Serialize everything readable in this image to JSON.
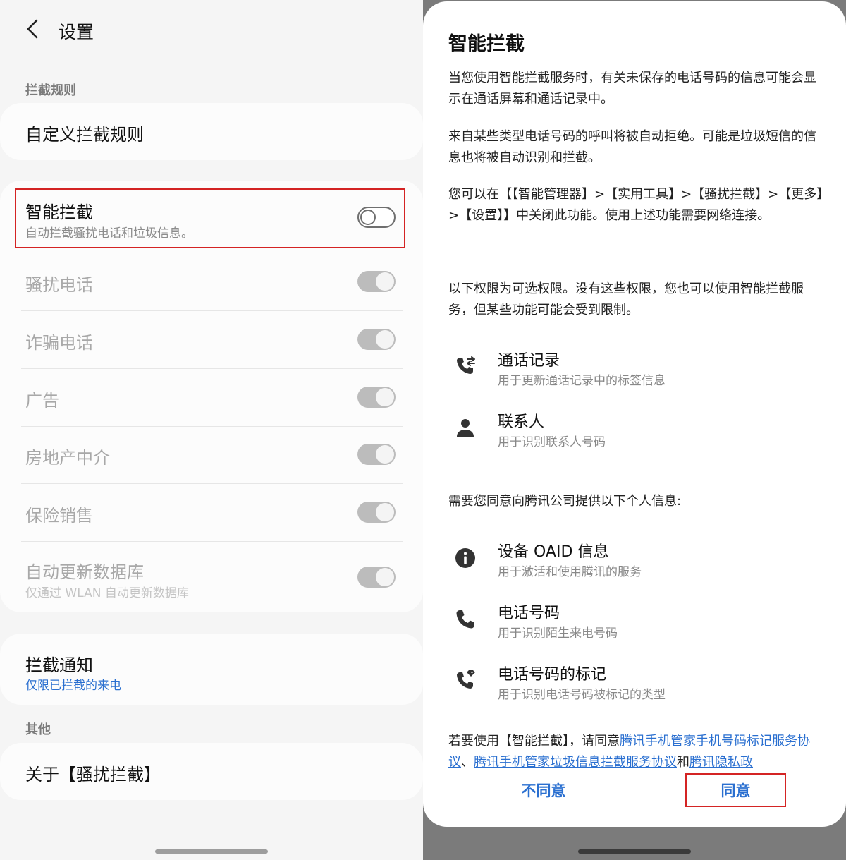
{
  "settings": {
    "title": "设置",
    "section_rules": "拦截规则",
    "custom_rules": "自定义拦截规则",
    "smart_block": {
      "title": "智能拦截",
      "subtitle": "自动拦截骚扰电话和垃圾信息。",
      "enabled": false
    },
    "categories": [
      {
        "label": "骚扰电话"
      },
      {
        "label": "诈骗电话"
      },
      {
        "label": "广告"
      },
      {
        "label": "房地产中介"
      },
      {
        "label": "保险销售"
      }
    ],
    "auto_update": {
      "title": "自动更新数据库",
      "subtitle": "仅通过 WLAN 自动更新数据库"
    },
    "block_notice": {
      "title": "拦截通知",
      "subtitle": "仅限已拦截的来电"
    },
    "section_other": "其他",
    "about": "关于【骚扰拦截】"
  },
  "dialog": {
    "title": "智能拦截",
    "p1": "当您使用智能拦截服务时，有关未保存的电话号码的信息可能会显示在通话屏幕和通话记录中。",
    "p2": "来自某些类型电话号码的呼叫将被自动拒绝。可能是垃圾短信的信息也将被自动识别和拦截。",
    "p3": "您可以在【【智能管理器】>【实用工具】>【骚扰拦截】>【更多】>【设置】】中关闭此功能。使用上述功能需要网络连接。",
    "p4": "以下权限为可选权限。没有这些权限，您也可以使用智能拦截服务，但某些功能可能会受到限制。",
    "optional_permissions": [
      {
        "icon": "call-log-icon",
        "title": "通话记录",
        "subtitle": "用于更新通话记录中的标签信息"
      },
      {
        "icon": "contact-icon",
        "title": "联系人",
        "subtitle": "用于识别联系人号码"
      }
    ],
    "p5": "需要您同意向腾讯公司提供以下个人信息:",
    "personal_info": [
      {
        "icon": "info-icon",
        "title": "设备 OAID 信息",
        "subtitle": "用于激活和使用腾讯的服务"
      },
      {
        "icon": "phone-icon",
        "title": "电话号码",
        "subtitle": "用于识别陌生来电号码"
      },
      {
        "icon": "phone-tag-icon",
        "title": "电话号码的标记",
        "subtitle": "用于识别电话号码被标记的类型"
      }
    ],
    "agree_prefix": "若要使用【智能拦截】，请同意",
    "link1": "腾讯手机管家手机号码标记服务协议",
    "sep1": "、",
    "link2": "腾讯手机管家垃圾信息拦截服务协议",
    "sep2": "和",
    "link3": "腾讯隐私政",
    "disagree": "不同意",
    "agree": "同意"
  },
  "colors": {
    "accent": "#2a6fd0",
    "highlight": "#d42424"
  }
}
